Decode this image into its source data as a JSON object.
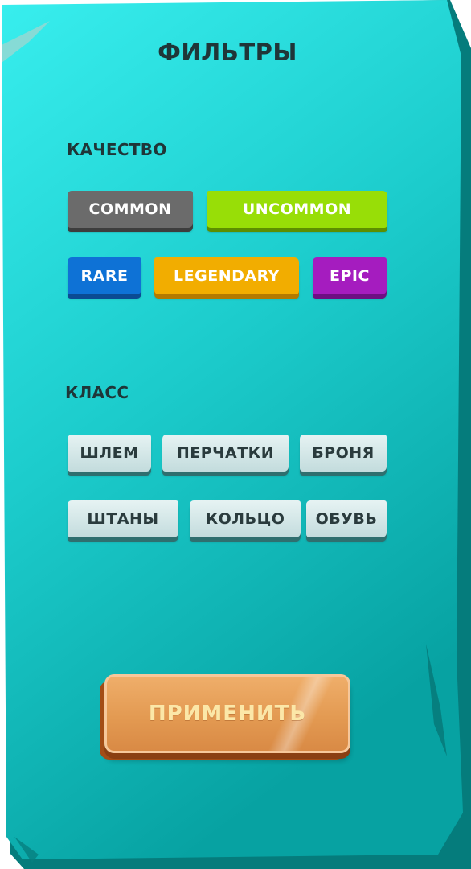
{
  "title": "ФИЛЬТРЫ",
  "quality": {
    "label": "КАЧЕСТВО",
    "chips": [
      {
        "label": "COMMON",
        "color": "#6b6b6b",
        "shadow": "#3d3d3d"
      },
      {
        "label": "UNCOMMON",
        "color": "#98de07",
        "shadow": "#5d8f00"
      },
      {
        "label": "RARE",
        "color": "#0e72d6",
        "shadow": "#0a4b93"
      },
      {
        "label": "LEGENDARY",
        "color": "#f2ad00",
        "shadow": "#b47a00"
      },
      {
        "label": "EPIC",
        "color": "#a51cbf",
        "shadow": "#6d0f83"
      }
    ]
  },
  "class": {
    "label": "КЛАСС",
    "chips": [
      {
        "label": "ШЛЕМ"
      },
      {
        "label": "ПЕРЧАТКИ"
      },
      {
        "label": "БРОНЯ"
      },
      {
        "label": "ШТАНЫ"
      },
      {
        "label": "КОЛЬЦО"
      },
      {
        "label": "ОБУВЬ"
      }
    ]
  },
  "apply_label": "ПРИМЕНИТЬ",
  "colors": {
    "panel_top": "#36eded",
    "panel_bottom": "#08a3a3",
    "panel_edge": "#067f7f",
    "text_dark": "#1f3638",
    "apply_button": "#e39a52"
  }
}
